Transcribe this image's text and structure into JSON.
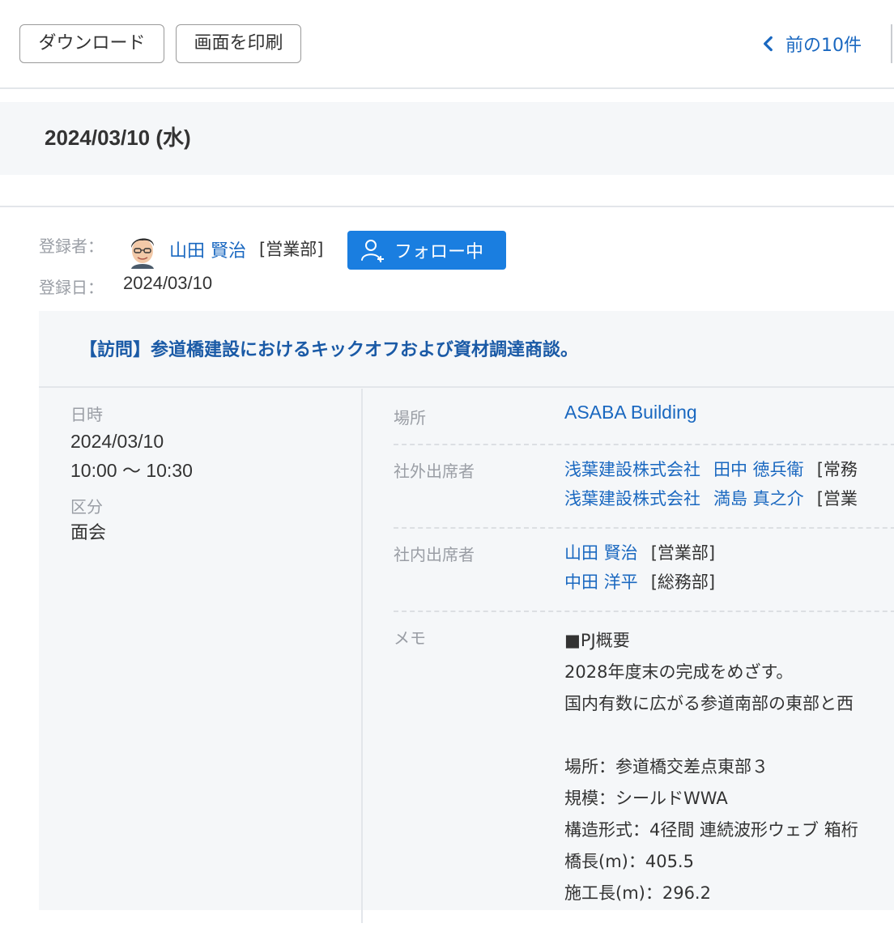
{
  "toolbar": {
    "download_label": "ダウンロード",
    "print_label": "画面を印刷",
    "prev_label": "前の10件"
  },
  "date_header": "2024/03/10 (水)",
  "registrant": {
    "label_registrant": "登録者：",
    "name": "山田 賢治",
    "dept": "[営業部]",
    "follow_label": "フォロー中",
    "label_date": "登録日：",
    "date": "2024/03/10"
  },
  "report": {
    "title": "【訪問】参道橋建設におけるキックオフおよび資材調達商談。",
    "datetime_label": "日時",
    "date": "2024/03/10",
    "time": "10:00 ～ 10:30",
    "category_label": "区分",
    "category": "面会",
    "place_label": "場所",
    "place": "ASABA Building",
    "external_label": "社外出席者",
    "external": [
      {
        "company": "浅葉建設株式会社",
        "name": "田中 徳兵衛",
        "dept": "[常務"
      },
      {
        "company": "浅葉建設株式会社",
        "name": "満島 真之介",
        "dept": "[営業"
      }
    ],
    "internal_label": "社内出席者",
    "internal": [
      {
        "name": "山田 賢治",
        "dept": "[営業部]"
      },
      {
        "name": "中田 洋平",
        "dept": "[総務部]"
      }
    ],
    "memo_label": "メモ",
    "memo_lines": [
      "■PJ概要",
      "2028年度末の完成をめざす。",
      "国内有数に広がる参道南部の東部と西",
      "",
      "場所：参道橋交差点東部３",
      "規模：シールドWWA",
      "構造形式：4径間 連続波形ウェブ 箱桁",
      "橋長(m)：405.5",
      "施工長(m)：296.2"
    ]
  },
  "colors": {
    "accent": "#1a68c0",
    "follow_bg": "#1a7ee0",
    "title": "#1a5aa6",
    "band_bg": "#f5f7f9"
  }
}
